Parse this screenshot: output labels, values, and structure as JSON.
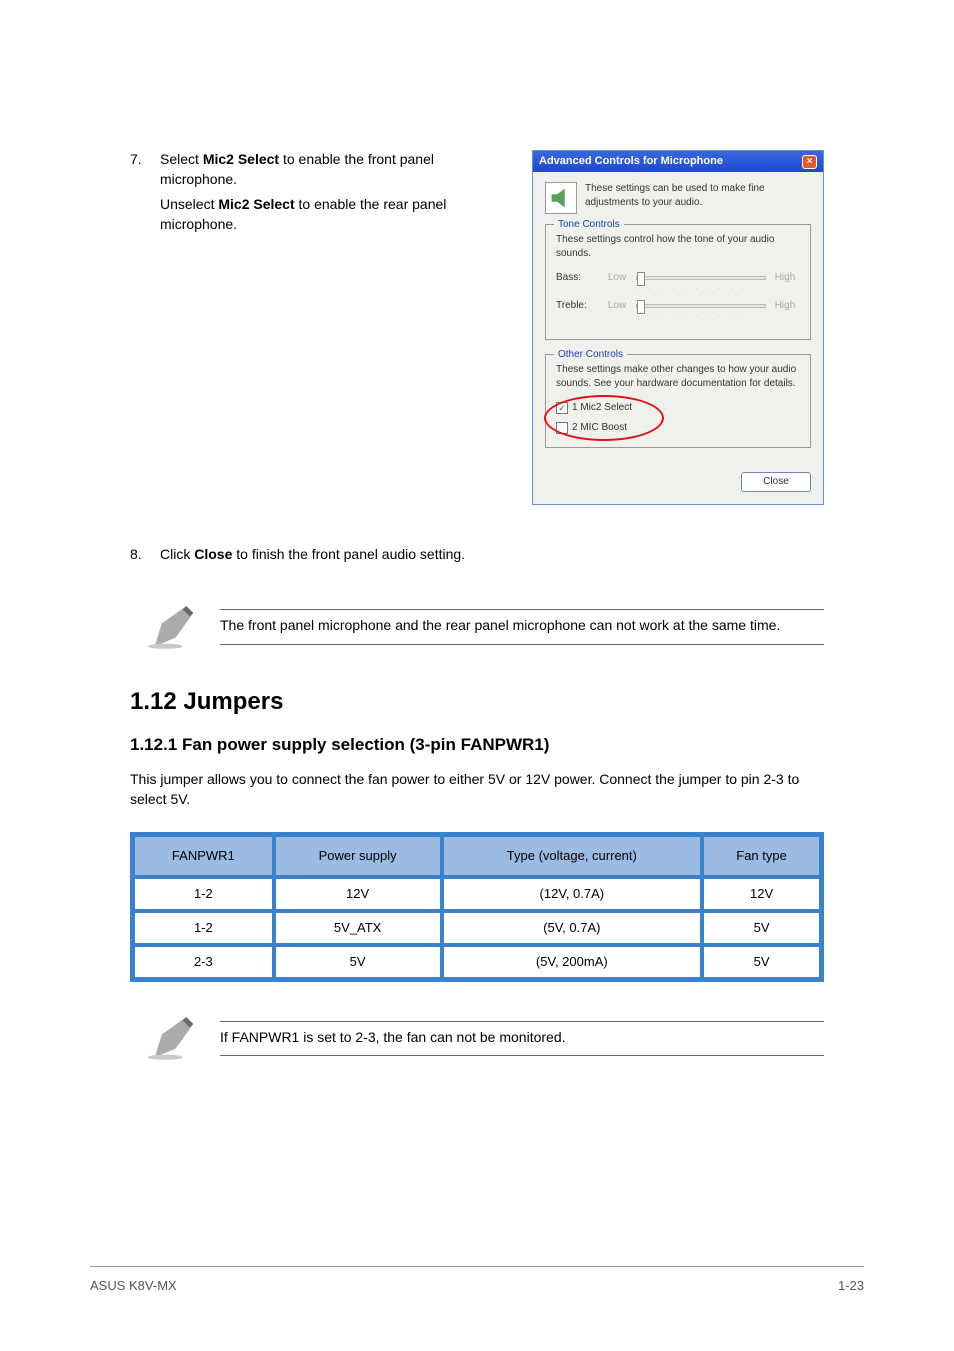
{
  "step7": {
    "num": "7.",
    "line1_a": "Select ",
    "line1_b": "Mic2 Select",
    "line1_c": " to enable the front panel microphone.",
    "line2_a": "Unselect ",
    "line2_b": "Mic2 Select",
    "line2_c": " to enable the rear panel microphone."
  },
  "step8": {
    "num": "8.",
    "line_a": "Click ",
    "line_b": "Close",
    "line_c": " to finish the front panel audio setting."
  },
  "dlg": {
    "title": "Advanced Controls for Microphone",
    "top_text": "These settings can be used to make fine adjustments to your audio.",
    "tone_legend": "Tone Controls",
    "tone_desc": "These settings control how the tone of your audio sounds.",
    "bass_label": "Bass:",
    "treble_label": "Treble:",
    "low": "Low",
    "high": "High",
    "other_legend": "Other Controls",
    "other_desc": "These settings make other changes to how your audio sounds. See your hardware documentation for details.",
    "chk1": "1  Mic2 Select",
    "chk2": "2  MIC Boost",
    "close_btn": "Close"
  },
  "note1": "The front panel microphone and the rear panel microphone can not work at the same time.",
  "jumpers": {
    "title": "1.12 Jumpers",
    "subtitle": "1.12.1   Fan power supply selection (3-pin FANPWR1)",
    "body": "This jumper allows you to connect the fan power to either 5V or 12V power. Connect the jumper to pin 2-3 to select 5V."
  },
  "table": {
    "headers": [
      "FANPWR1",
      "Power supply",
      "Type (voltage, current)",
      "Fan type"
    ],
    "rows": [
      [
        "1-2",
        "12V",
        "(12V, 0.7A)",
        "12V"
      ],
      [
        "1-2",
        "5V_ATX",
        "(5V, 0.7A)",
        "5V"
      ],
      [
        "2-3",
        "5V",
        "(5V, 200mA)",
        "5V"
      ]
    ]
  },
  "note2": "If FANPWR1 is set to 2-3, the fan can not be monitored.",
  "footer": {
    "left": "ASUS K8V-MX",
    "right": "1-23"
  }
}
